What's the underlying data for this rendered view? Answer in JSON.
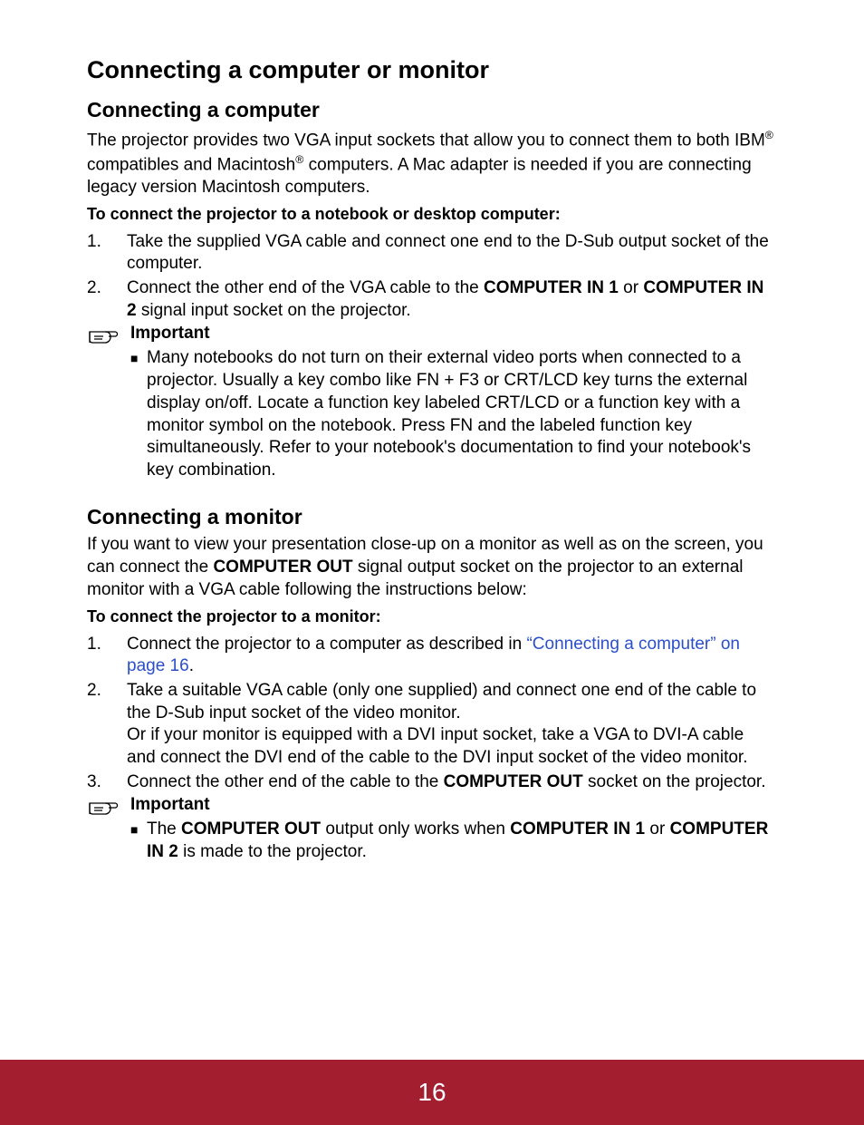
{
  "page": {
    "number": "16",
    "title": "Connecting a computer or monitor"
  },
  "section_computer": {
    "heading": "Connecting a computer",
    "intro_pre": "The projector provides two VGA input sockets that allow you to connect them to both IBM",
    "intro_mid1": " compatibles and Macintosh",
    "intro_post": " computers. A Mac adapter is needed if you are connecting legacy version Macintosh computers.",
    "howto": "To connect the projector to a notebook or desktop computer:",
    "step1": "Take the supplied VGA cable and connect one end to the D-Sub output socket of the computer.",
    "step2_pre": "Connect the other end of the VGA cable to the ",
    "step2_b1": "COMPUTER IN 1",
    "step2_mid": " or ",
    "step2_b2": "COMPUTER IN 2",
    "step2_post": " signal input socket on the projector.",
    "important_label": "Important",
    "important_text": "Many notebooks do not turn on their external video ports when connected to a projector. Usually a key combo like FN + F3 or CRT/LCD key turns the external display on/off. Locate a function key labeled CRT/LCD or a function key with a monitor symbol on the notebook. Press FN and the labeled function key simultaneously. Refer to your notebook's documentation to find your notebook's key combination."
  },
  "section_monitor": {
    "heading": "Connecting a monitor",
    "intro_pre": "If you want to view your presentation close-up on a monitor as well as on the screen, you can connect the ",
    "intro_b1": "COMPUTER OUT",
    "intro_post": " signal output socket on the projector to an external monitor with a VGA cable following the instructions below:",
    "howto": "To connect the projector to a monitor:",
    "step1_pre": "Connect the projector to a computer as described in ",
    "step1_link": "“Connecting a computer” on page 16",
    "step1_post": ".",
    "step2": "Take a suitable VGA cable (only one supplied) and connect one end of the cable to the  D-Sub input socket of the video monitor.\nOr if your monitor is equipped with a DVI input socket, take a VGA to DVI-A cable and connect the DVI end of the cable to the DVI input socket of the video monitor.",
    "step3_pre": "Connect the other end of the cable to the ",
    "step3_b1": "COMPUTER OUT",
    "step3_post": " socket on the projector.",
    "important_label": "Important",
    "important_pre": "The ",
    "important_b1": "COMPUTER OUT",
    "important_mid1": " output only works when ",
    "important_b2": "COMPUTER IN 1",
    "important_mid2": " or ",
    "important_b3": "COMPUTER IN 2",
    "important_post": " is made to the projector."
  },
  "labels": {
    "reg": "®",
    "bullet": "■",
    "n1": "1.",
    "n2": "2.",
    "n3": "3."
  }
}
